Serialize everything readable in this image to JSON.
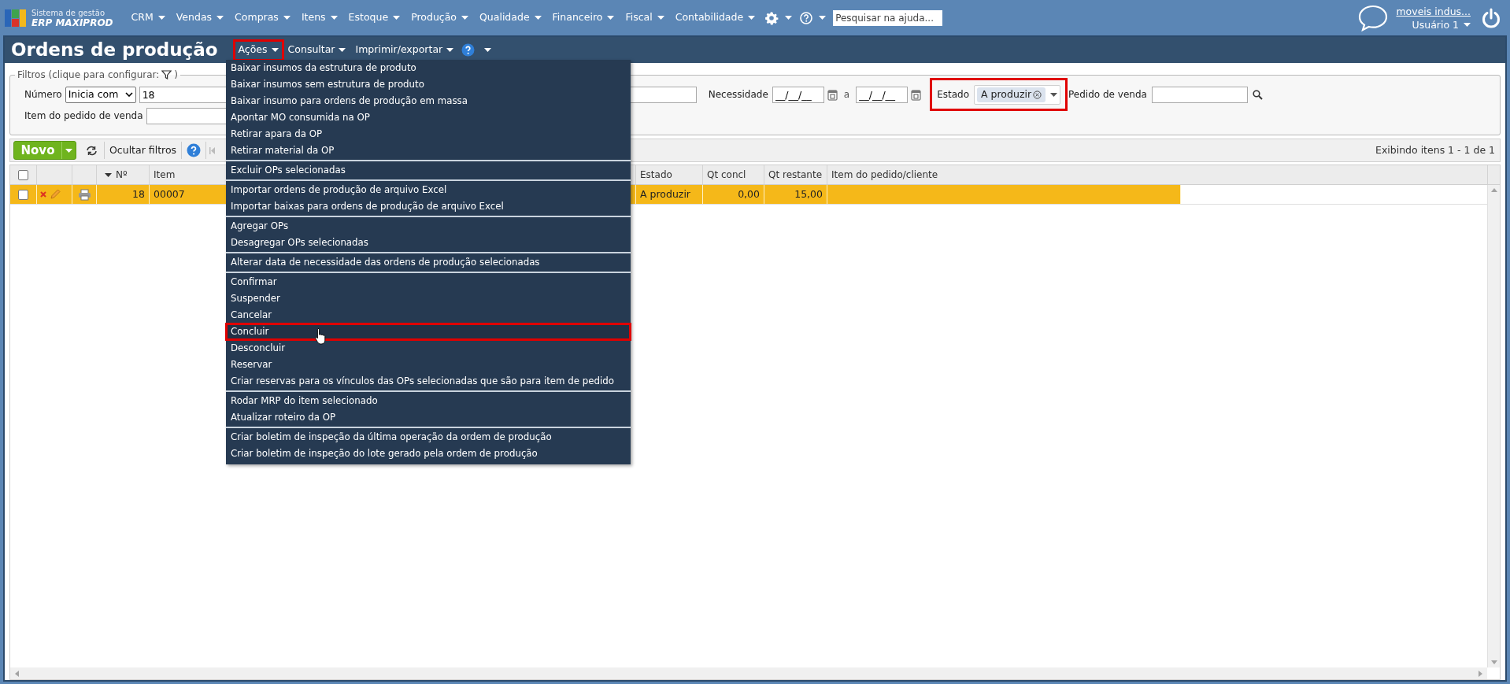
{
  "header": {
    "logo_line1": "Sistema de gestão",
    "logo_line2": "ERP MAXIPROD",
    "nav": [
      "CRM",
      "Vendas",
      "Compras",
      "Itens",
      "Estoque",
      "Produção",
      "Qualidade",
      "Financeiro",
      "Fiscal",
      "Contabilidade"
    ],
    "help_search": {
      "placeholder": "Pesquisar na ajuda..."
    },
    "company": "moveis indus...",
    "user": "Usuário 1"
  },
  "page": {
    "title": "Ordens de produção",
    "menus": [
      {
        "label": "Ações",
        "callout": true
      },
      {
        "label": "Consultar",
        "callout": false
      },
      {
        "label": "Imprimir/exportar",
        "callout": false
      }
    ]
  },
  "actions_menu": {
    "groups": [
      [
        {
          "label": "Baixar insumos da estrutura de produto",
          "selected": false,
          "callout": false
        },
        {
          "label": "Baixar insumos sem estrutura de produto",
          "selected": false,
          "callout": false
        },
        {
          "label": "Baixar insumo para ordens de produção em massa",
          "selected": false,
          "callout": false
        },
        {
          "label": "Apontar MO consumida na OP",
          "selected": false,
          "callout": false
        },
        {
          "label": "Retirar apara da OP",
          "selected": false,
          "callout": false
        },
        {
          "label": "Retirar material da OP",
          "selected": false,
          "callout": false
        }
      ],
      [
        {
          "label": "Excluir OPs selecionadas",
          "selected": false,
          "callout": false
        }
      ],
      [
        {
          "label": "Importar ordens de produção de arquivo Excel",
          "selected": false,
          "callout": false
        },
        {
          "label": "Importar baixas para ordens de produção de arquivo Excel",
          "selected": false,
          "callout": false
        }
      ],
      [
        {
          "label": "Agregar OPs",
          "selected": false,
          "callout": false
        },
        {
          "label": "Desagregar OPs selecionadas",
          "selected": false,
          "callout": false
        }
      ],
      [
        {
          "label": "Alterar data de necessidade das ordens de produção selecionadas",
          "selected": false,
          "callout": false
        }
      ],
      [
        {
          "label": "Confirmar",
          "selected": false,
          "callout": false
        },
        {
          "label": "Suspender",
          "selected": false,
          "callout": false
        },
        {
          "label": "Cancelar",
          "selected": false,
          "callout": false
        },
        {
          "label": "Concluir",
          "selected": true,
          "callout": true
        },
        {
          "label": "Desconcluir",
          "selected": false,
          "callout": false
        },
        {
          "label": "Reservar",
          "selected": false,
          "callout": false
        },
        {
          "label": "Criar reservas para os vínculos das OPs selecionadas que são para item de pedido",
          "selected": false,
          "callout": false
        }
      ],
      [
        {
          "label": "Rodar MRP do item selecionado",
          "selected": false,
          "callout": false
        },
        {
          "label": "Atualizar roteiro da OP",
          "selected": false,
          "callout": false
        }
      ],
      [
        {
          "label": "Criar boletim de inspeção da última operação da ordem de produção",
          "selected": false,
          "callout": false
        },
        {
          "label": "Criar boletim de inspeção do lote gerado pela ordem de produção",
          "selected": false,
          "callout": false
        }
      ]
    ]
  },
  "filters": {
    "legend": "Filtros (clique para configurar:",
    "legend_end": ")",
    "numero": {
      "label": "Número",
      "mode": "Inicia com",
      "value": "18"
    },
    "item_pedido": {
      "label": "Item do pedido de venda"
    },
    "necessidade": {
      "label": "Necessidade",
      "from": "__/__/__",
      "separator": "a",
      "to": "__/__/__"
    },
    "estado": {
      "label": "Estado",
      "chips": [
        "A produzir"
      ],
      "callout": true
    },
    "pedido": {
      "label": "Pedido de venda"
    }
  },
  "toolbar": {
    "new_button": "Novo",
    "hide_filters": "Ocultar filtros",
    "pager_info": "Exibindo itens 1 - 1 de 1"
  },
  "table": {
    "columns": [
      {
        "kind": "checkbox",
        "checked": false
      },
      {
        "kind": "actions"
      },
      {
        "kind": "print"
      },
      {
        "kind": "number",
        "label": "Nº",
        "sorted": true
      },
      {
        "kind": "text",
        "label": "Item",
        "sorted": false
      },
      {
        "kind": "text",
        "label": "Estado",
        "sorted": false
      },
      {
        "kind": "number",
        "label": "Qt concl",
        "sorted": false
      },
      {
        "kind": "number",
        "label": "Qt restante",
        "sorted": false
      },
      {
        "kind": "text",
        "label": "Item do pedido/cliente",
        "sorted": false
      }
    ],
    "rows": [
      {
        "selected": true,
        "checked": false,
        "cells": [
          "",
          "",
          "",
          "18",
          "00007",
          "A produzir",
          "0,00",
          "15,00",
          ""
        ]
      }
    ]
  }
}
